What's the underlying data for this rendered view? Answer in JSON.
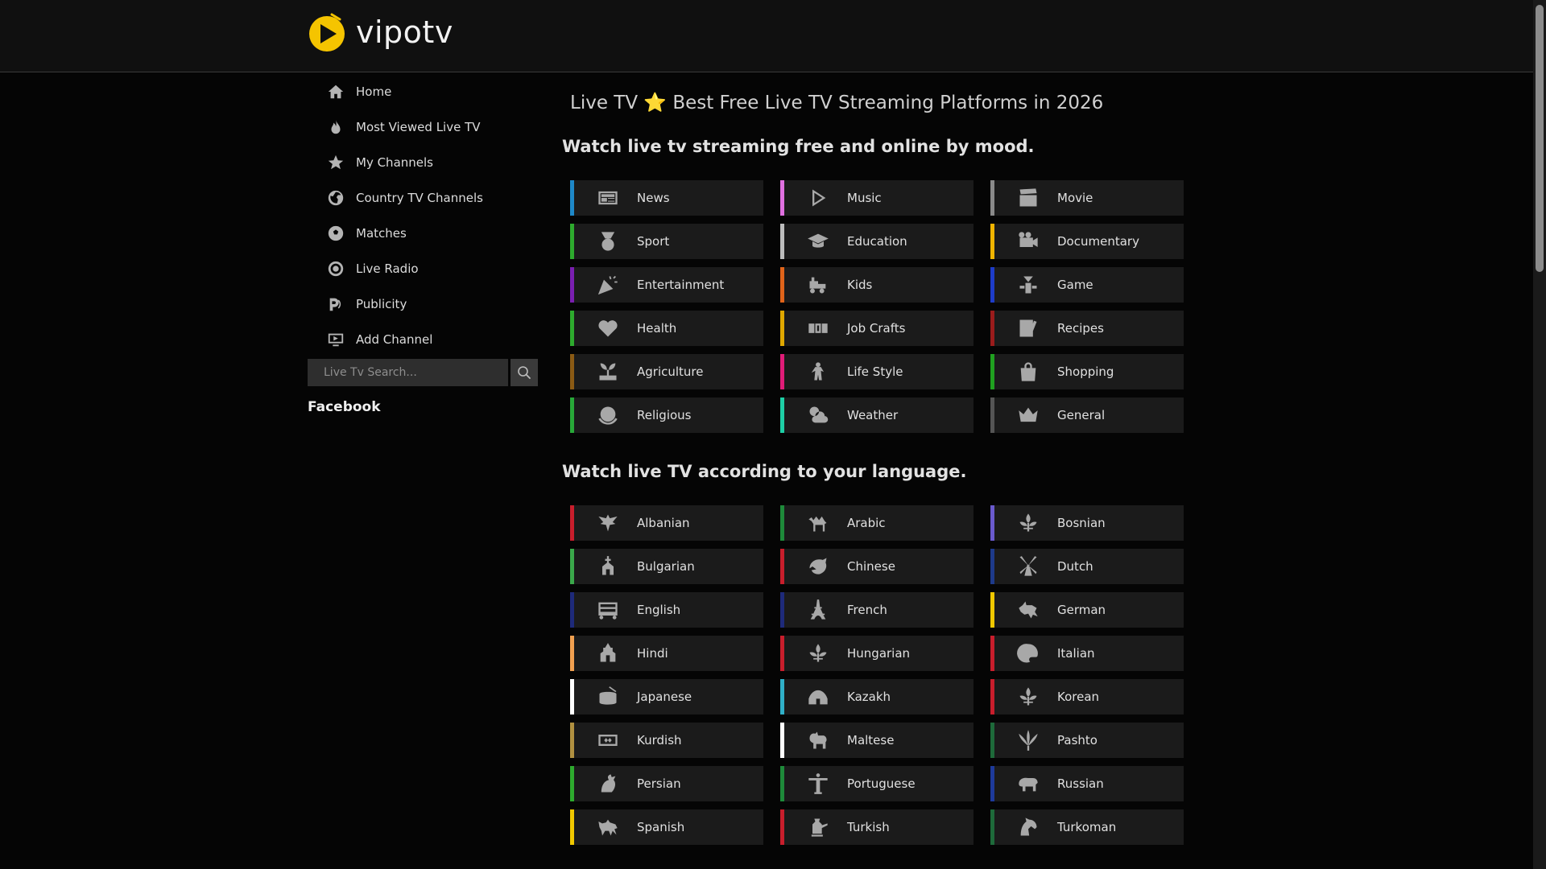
{
  "brand": {
    "name": "vipotv",
    "accent": "#f5c400"
  },
  "nav": [
    {
      "label": "Home",
      "icon": "home-icon"
    },
    {
      "label": "Most Viewed Live TV",
      "icon": "fire-icon"
    },
    {
      "label": "My Channels",
      "icon": "star-icon"
    },
    {
      "label": "Country TV Channels",
      "icon": "globe-icon"
    },
    {
      "label": "Matches",
      "icon": "soccer-ball-icon"
    },
    {
      "label": "Live Radio",
      "icon": "radio-icon"
    },
    {
      "label": "Publicity",
      "icon": "megaphone-icon"
    },
    {
      "label": "Add Channel",
      "icon": "tv-plus-icon"
    }
  ],
  "search": {
    "placeholder": "Live Tv Search..."
  },
  "social": {
    "facebook": "Facebook"
  },
  "page": {
    "title": "Live TV ⭐ Best Free Live TV Streaming Platforms in 2026",
    "mood_heading": "Watch live tv streaming free and online by mood.",
    "language_heading": "Watch live TV according to your language."
  },
  "moods": [
    {
      "label": "News",
      "color": "#1e88c8",
      "icon": "newspaper-icon"
    },
    {
      "label": "Music",
      "color": "#e070e0",
      "icon": "play-icon"
    },
    {
      "label": "Movie",
      "color": "#8a8a8a",
      "icon": "clapperboard-icon"
    },
    {
      "label": "Sport",
      "color": "#2eaa2e",
      "icon": "medal-icon"
    },
    {
      "label": "Education",
      "color": "#bdbdbd",
      "icon": "graduation-cap-icon"
    },
    {
      "label": "Documentary",
      "color": "#f0b400",
      "icon": "camera-icon"
    },
    {
      "label": "Entertainment",
      "color": "#7a1fb0",
      "icon": "party-popper-icon"
    },
    {
      "label": "Kids",
      "color": "#e0641a",
      "icon": "toy-train-icon"
    },
    {
      "label": "Game",
      "color": "#1e3cc8",
      "icon": "game-icon"
    },
    {
      "label": "Health",
      "color": "#2eaa2e",
      "icon": "heart-icon"
    },
    {
      "label": "Job Crafts",
      "color": "#e0a800",
      "icon": "job-icon"
    },
    {
      "label": "Recipes",
      "color": "#9a1c1c",
      "icon": "recipe-icon"
    },
    {
      "label": "Agriculture",
      "color": "#8a5a14",
      "icon": "sprout-icon"
    },
    {
      "label": "Life Style",
      "color": "#e01c78",
      "icon": "dancer-icon"
    },
    {
      "label": "Shopping",
      "color": "#20a020",
      "icon": "shopping-bag-icon"
    },
    {
      "label": "Religious",
      "color": "#28a838",
      "icon": "globe-hands-icon"
    },
    {
      "label": "Weather",
      "color": "#1ecfa6",
      "icon": "weather-icon"
    },
    {
      "label": "General",
      "color": "#555555",
      "icon": "crown-icon"
    }
  ],
  "languages": [
    {
      "label": "Albanian",
      "color": "#c81e2c",
      "icon": "eagle-icon"
    },
    {
      "label": "Arabic",
      "color": "#1e8a3a",
      "icon": "camel-icon"
    },
    {
      "label": "Bosnian",
      "color": "#6a5acd",
      "icon": "fleur-de-lis-icon"
    },
    {
      "label": "Bulgarian",
      "color": "#3aa84a",
      "icon": "church-icon"
    },
    {
      "label": "Chinese",
      "color": "#c81e2c",
      "icon": "dragon-icon"
    },
    {
      "label": "Dutch",
      "color": "#1e3a8a",
      "icon": "windmill-icon"
    },
    {
      "label": "English",
      "color": "#1e2a7a",
      "icon": "bus-icon"
    },
    {
      "label": "French",
      "color": "#1e2a7a",
      "icon": "eiffel-tower-icon"
    },
    {
      "label": "German",
      "color": "#f0c800",
      "icon": "wolf-icon"
    },
    {
      "label": "Hindi",
      "color": "#f0a050",
      "icon": "temple-icon"
    },
    {
      "label": "Hungarian",
      "color": "#c81e2c",
      "icon": "fleur-de-lis-icon"
    },
    {
      "label": "Italian",
      "color": "#c81e2c",
      "icon": "palette-icon"
    },
    {
      "label": "Japanese",
      "color": "#ffffff",
      "icon": "drum-icon"
    },
    {
      "label": "Kazakh",
      "color": "#30b0c8",
      "icon": "yurt-icon"
    },
    {
      "label": "Korean",
      "color": "#c81e2c",
      "icon": "fleur-de-lis-icon"
    },
    {
      "label": "Kurdish",
      "color": "#b09040",
      "icon": "pattern-icon"
    },
    {
      "label": "Maltese",
      "color": "#ffffff",
      "icon": "dog-icon"
    },
    {
      "label": "Pashto",
      "color": "#1e6a3a",
      "icon": "leaf-icon"
    },
    {
      "label": "Persian",
      "color": "#2eaa2e",
      "icon": "griffin-icon"
    },
    {
      "label": "Portuguese",
      "color": "#1e8a3a",
      "icon": "christ-statue-icon"
    },
    {
      "label": "Russian",
      "color": "#1e3a9a",
      "icon": "bear-icon"
    },
    {
      "label": "Spanish",
      "color": "#f0c800",
      "icon": "bull-icon"
    },
    {
      "label": "Turkish",
      "color": "#c81e2c",
      "icon": "coffee-pot-icon"
    },
    {
      "label": "Turkoman",
      "color": "#1e6a3a",
      "icon": "horse-icon"
    }
  ]
}
